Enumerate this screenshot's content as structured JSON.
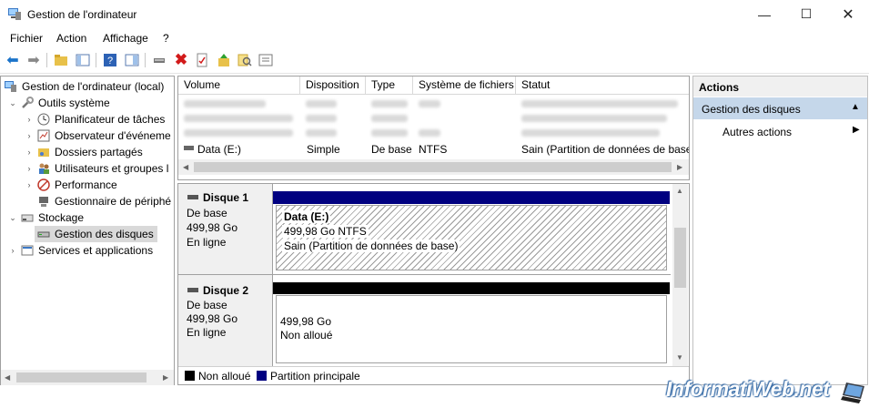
{
  "window": {
    "title": "Gestion de l'ordinateur"
  },
  "menu": [
    "Fichier",
    "Action",
    "Affichage",
    "?"
  ],
  "tree": {
    "root": "Gestion de l'ordinateur (local)",
    "system_tools": "Outils système",
    "task_scheduler": "Planificateur de tâches",
    "event_viewer": "Observateur d'événeme",
    "shared_folders": "Dossiers partagés",
    "users_groups": "Utilisateurs et groupes l",
    "performance": "Performance",
    "device_manager": "Gestionnaire de périphé",
    "storage": "Stockage",
    "disk_management": "Gestion des disques",
    "services_apps": "Services et applications"
  },
  "volume_table": {
    "columns": [
      "Volume",
      "Disposition",
      "Type",
      "Système de fichiers",
      "Statut"
    ],
    "visible_row": {
      "volume": "Data (E:)",
      "layout": "Simple",
      "type": "De base",
      "fs": "NTFS",
      "status": "Sain (Partition de données de base)"
    }
  },
  "disks": [
    {
      "name": "Disque 1",
      "type": "De base",
      "size": "499,98 Go",
      "state": "En ligne",
      "partition": {
        "title": "Data  (E:)",
        "size": "499,98 Go NTFS",
        "status": "Sain (Partition de données de base)"
      }
    },
    {
      "name": "Disque 2",
      "type": "De base",
      "size": "499,98 Go",
      "state": "En ligne",
      "partition": {
        "size": "499,98 Go",
        "status": "Non alloué"
      }
    }
  ],
  "legend": {
    "unallocated": "Non alloué",
    "primary": "Partition principale"
  },
  "actions": {
    "header": "Actions",
    "section": "Gestion des disques",
    "more": "Autres actions"
  },
  "watermark": "InformatiWeb.net",
  "colors": {
    "primary_partition": "#000080",
    "unallocated": "#000000",
    "selection": "#cce8ff",
    "actions_section": "#c5d7ea"
  }
}
